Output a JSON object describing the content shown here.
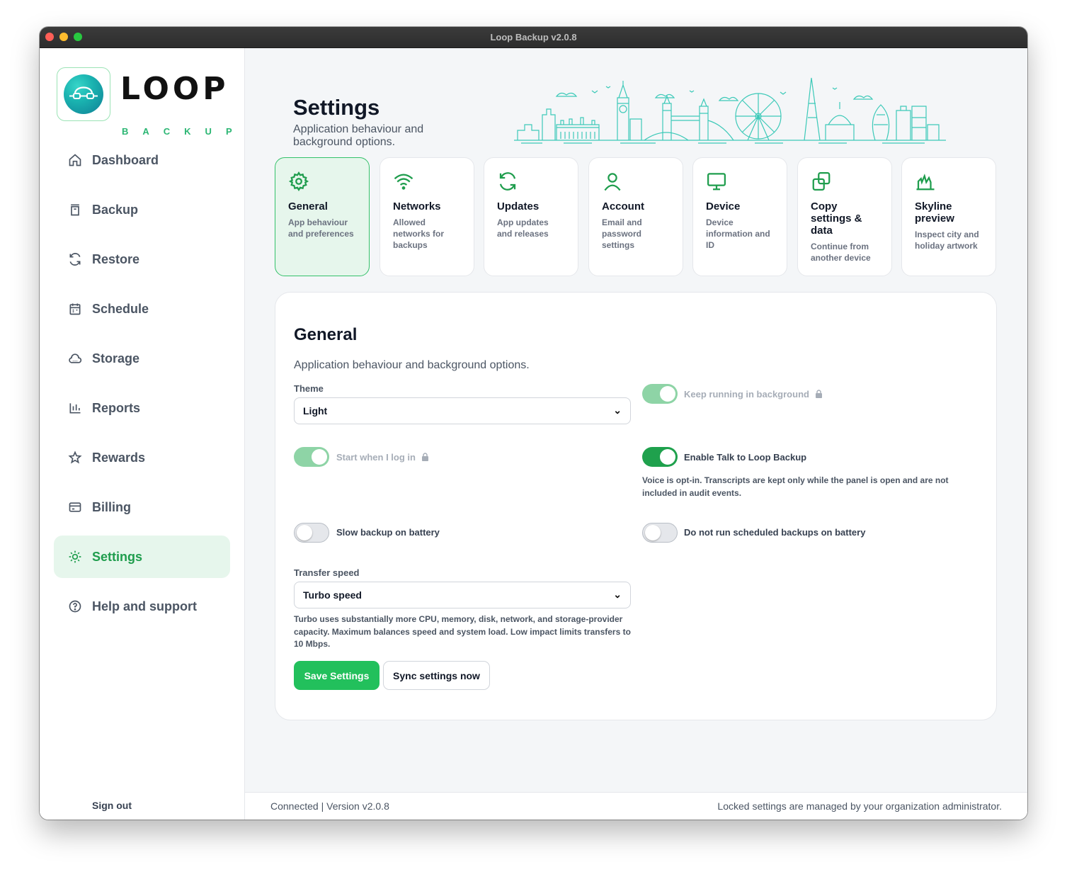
{
  "window": {
    "title": "Loop Backup v2.0.8"
  },
  "logo": {
    "word": "LOOP",
    "sub": "BACKUP"
  },
  "sidebar": {
    "items": [
      {
        "label": "Dashboard",
        "icon": "home-icon"
      },
      {
        "label": "Backup",
        "icon": "archive-icon"
      },
      {
        "label": "Restore",
        "icon": "refresh-icon"
      },
      {
        "label": "Schedule",
        "icon": "calendar-icon"
      },
      {
        "label": "Storage",
        "icon": "cloud-icon"
      },
      {
        "label": "Reports",
        "icon": "bar-chart-icon"
      },
      {
        "label": "Rewards",
        "icon": "star-icon"
      },
      {
        "label": "Billing",
        "icon": "credit-card-icon"
      },
      {
        "label": "Settings",
        "icon": "sun-gear-icon",
        "active": true
      },
      {
        "label": "Help and support",
        "icon": "help-circle-icon"
      }
    ],
    "sign_out": "Sign out"
  },
  "header": {
    "title": "Settings",
    "subtitle": "Application behaviour and background options."
  },
  "cards": [
    {
      "title": "General",
      "desc": "App behaviour and preferences",
      "icon": "gear-icon",
      "active": true
    },
    {
      "title": "Networks",
      "desc": "Allowed networks for backups",
      "icon": "wifi-icon"
    },
    {
      "title": "Updates",
      "desc": "App updates and releases",
      "icon": "refresh-icon"
    },
    {
      "title": "Account",
      "desc": "Email and password settings",
      "icon": "user-icon"
    },
    {
      "title": "Device",
      "desc": "Device information and ID",
      "icon": "monitor-icon"
    },
    {
      "title": "Copy settings & data",
      "desc": "Continue from another device",
      "icon": "copy-icon"
    },
    {
      "title": "Skyline preview",
      "desc": "Inspect city and holiday artwork",
      "icon": "skyline-icon"
    }
  ],
  "general": {
    "title": "General",
    "subtitle": "Application behaviour and background options.",
    "theme_label": "Theme",
    "theme_value": "Light",
    "keep_running": {
      "label": "Keep running in background",
      "on": true,
      "locked": true
    },
    "start_login": {
      "label": "Start when I log in",
      "on": true,
      "locked": true
    },
    "talk": {
      "label": "Enable Talk to Loop Backup",
      "on": true,
      "help": "Voice is opt-in. Transcripts are kept only while the panel is open and are not included in audit events."
    },
    "slow_battery": {
      "label": "Slow backup on battery",
      "on": false
    },
    "no_sched_battery": {
      "label": "Do not run scheduled backups on battery",
      "on": false
    },
    "transfer_label": "Transfer speed",
    "transfer_value": "Turbo speed",
    "transfer_help": "Turbo uses substantially more CPU, memory, disk, network, and storage-provider capacity. Maximum balances speed and system load. Low impact limits transfers to 10 Mbps.",
    "save_label": "Save Settings",
    "sync_label": "Sync settings now"
  },
  "footer": {
    "status": "Connected | Version v2.0.8",
    "note": "Locked settings are managed by your organization administrator."
  },
  "colors": {
    "accent": "#22c05c",
    "accent_dark": "#1fa14d",
    "active_bg": "#e6f6ec",
    "skyline": "#3cc9b8"
  }
}
